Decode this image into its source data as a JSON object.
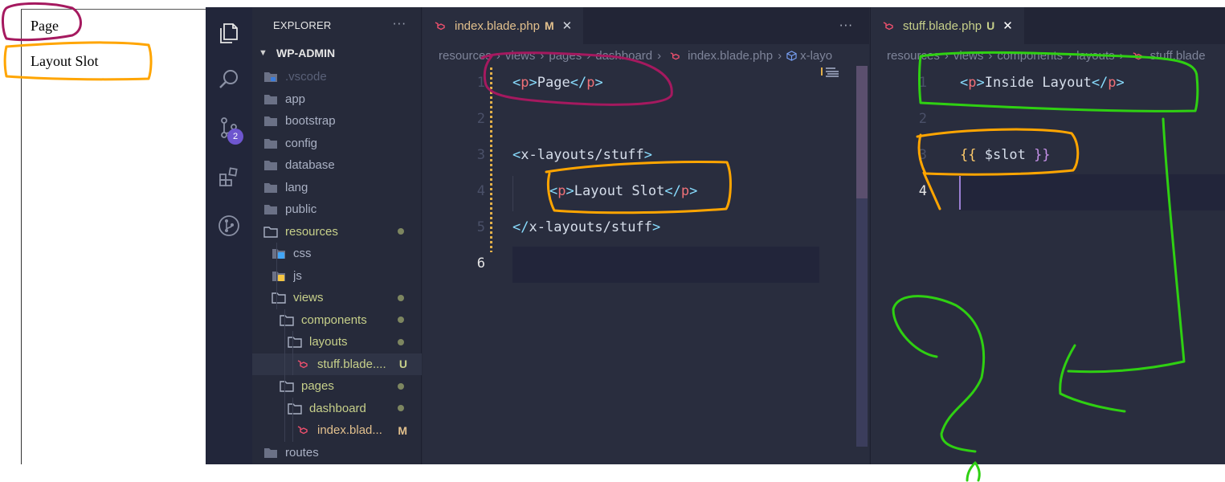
{
  "preview": {
    "line1": "Page",
    "line2": "Layout Slot"
  },
  "activity_bar": {
    "scm_badge": "2"
  },
  "explorer": {
    "title": "EXPLORER",
    "more": "···",
    "root": "WP-ADMIN",
    "items": [
      {
        "label": ".vscode",
        "status": "",
        "color": "#5a6178"
      },
      {
        "label": "app",
        "status": "",
        "color": "#aab1c4"
      },
      {
        "label": "bootstrap",
        "status": "",
        "color": "#aab1c4"
      },
      {
        "label": "config",
        "status": "",
        "color": "#aab1c4"
      },
      {
        "label": "database",
        "status": "",
        "color": "#aab1c4"
      },
      {
        "label": "lang",
        "status": "",
        "color": "#aab1c4"
      },
      {
        "label": "public",
        "status": "",
        "color": "#aab1c4"
      },
      {
        "label": "resources",
        "status": "dot",
        "color": "#c7d08a"
      },
      {
        "label": "css",
        "status": "",
        "color": "#aab1c4"
      },
      {
        "label": "js",
        "status": "",
        "color": "#aab1c4"
      },
      {
        "label": "views",
        "status": "dot",
        "color": "#c7d08a"
      },
      {
        "label": "components",
        "status": "dot",
        "color": "#c7d08a"
      },
      {
        "label": "layouts",
        "status": "dot",
        "color": "#c7d08a"
      },
      {
        "label": "stuff.blade....",
        "status": "U",
        "color": "#c7d08a"
      },
      {
        "label": "pages",
        "status": "dot",
        "color": "#c7d08a"
      },
      {
        "label": "dashboard",
        "status": "dot",
        "color": "#c7d08a"
      },
      {
        "label": "index.blad...",
        "status": "M",
        "color": "#e2c08d"
      },
      {
        "label": "routes",
        "status": "",
        "color": "#aab1c4"
      }
    ]
  },
  "editor1": {
    "tab": {
      "name": "index.blade.php",
      "status": "M",
      "close": "✕"
    },
    "more": "···",
    "breadcrumbs": [
      "resources",
      "views",
      "pages",
      "dashboard",
      "index.blade.php",
      "x-layo"
    ],
    "line_numbers": [
      "1",
      "2",
      "3",
      "4",
      "5",
      "6"
    ],
    "lines": {
      "l1_open": "<",
      "l1_tag": "p",
      "l1_close": ">",
      "l1_text": "Page",
      "l1_end_open": "</",
      "l1_end_tag": "p",
      "l1_end_close": ">",
      "l3_open": "<",
      "l3_name": "x-layouts/stuff",
      "l3_close": ">",
      "l4_open": "<",
      "l4_tag": "p",
      "l4_close": ">",
      "l4_text": "Layout Slot",
      "l4_end_open": "</",
      "l4_end_tag": "p",
      "l4_end_close": ">",
      "l5_open": "</",
      "l5_name": "x-layouts/stuff",
      "l5_close": ">"
    }
  },
  "editor2": {
    "tab": {
      "name": "stuff.blade.php",
      "status": "U",
      "close": "✕"
    },
    "breadcrumbs": [
      "resources",
      "views",
      "components",
      "layouts",
      "stuff.blade"
    ],
    "line_numbers": [
      "1",
      "2",
      "3",
      "4"
    ],
    "lines": {
      "l1_open": "<",
      "l1_tag": "p",
      "l1_close": ">",
      "l1_text": "Inside Layout",
      "l1_end_open": "</",
      "l1_end_tag": "p",
      "l1_end_close": ">",
      "l3_ob": "{{",
      "l3_var": " $slot ",
      "l3_cb": "}}"
    }
  },
  "colors": {
    "annot_magenta": "#a5195f",
    "annot_orange": "#ffa500",
    "annot_green": "#2fd012"
  }
}
